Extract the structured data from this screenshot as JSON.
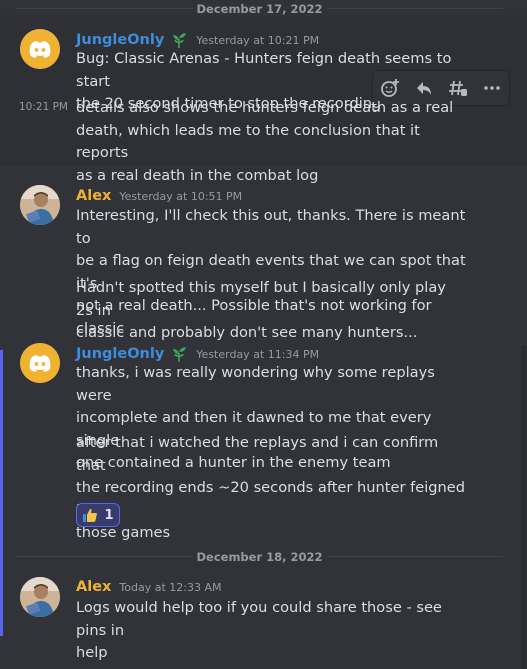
{
  "dividers": {
    "first": "December 17, 2022",
    "second": "December 18, 2022"
  },
  "messages": [
    {
      "author": "JungleOnly",
      "author_color": "#3e8ddd",
      "timestamp": "Yesterday at 10:21 PM",
      "avatar": "discord-logo-icon",
      "badge": "sprout-badge-icon",
      "lines": [
        "Bug: Classic Arenas - Hunters feign death seems to start",
        "the 20 second timer to stop the recording"
      ]
    },
    {
      "side_timestamp": "10:21 PM",
      "lines": [
        "details also shows the hunters feign death as a real",
        "death, which leads me to the conclusion that it reports",
        "as a real death in the combat log"
      ]
    },
    {
      "author": "Alex",
      "author_color": "#f0b232",
      "timestamp": "Yesterday at 10:51 PM",
      "avatar": "user-photo-avatar",
      "lines": [
        "Interesting, I'll check this out, thanks. There is meant to",
        "be a flag on feign death events that we can spot that it's",
        "not a real death... Possible that's not working for classic"
      ]
    },
    {
      "lines": [
        "Hadn't spotted this myself but I basically only play 2s in",
        "classic and probably don't see many hunters..."
      ]
    },
    {
      "author": "JungleOnly",
      "author_color": "#3e8ddd",
      "timestamp": "Yesterday at 11:34 PM",
      "avatar": "discord-logo-icon",
      "badge": "sprout-badge-icon",
      "lines": [
        "thanks, i was really wondering why some replays were",
        "incomplete and then it dawned to me that every single",
        "one contained a hunter in the enemy team"
      ]
    },
    {
      "lines": [
        "after that i watched the replays and i can confirm that",
        "the recording ends ~20 seconds after hunter feigned in",
        "those games"
      ],
      "reaction": {
        "emoji": "thumbs-up-icon",
        "count": "1"
      }
    },
    {
      "author": "Alex",
      "author_color": "#f0b232",
      "timestamp": "Today at 12:33 AM",
      "avatar": "user-photo-avatar",
      "lines": [
        "Logs would help too if you could share those - see pins in",
        "help"
      ]
    }
  ],
  "toolbar": [
    "add-reaction-icon",
    "reply-icon",
    "create-thread-icon",
    "more-options-icon"
  ],
  "colors": {
    "background": "#313338",
    "accent": "#5865f2",
    "text": "#dbdee1",
    "muted": "#949ba4"
  }
}
